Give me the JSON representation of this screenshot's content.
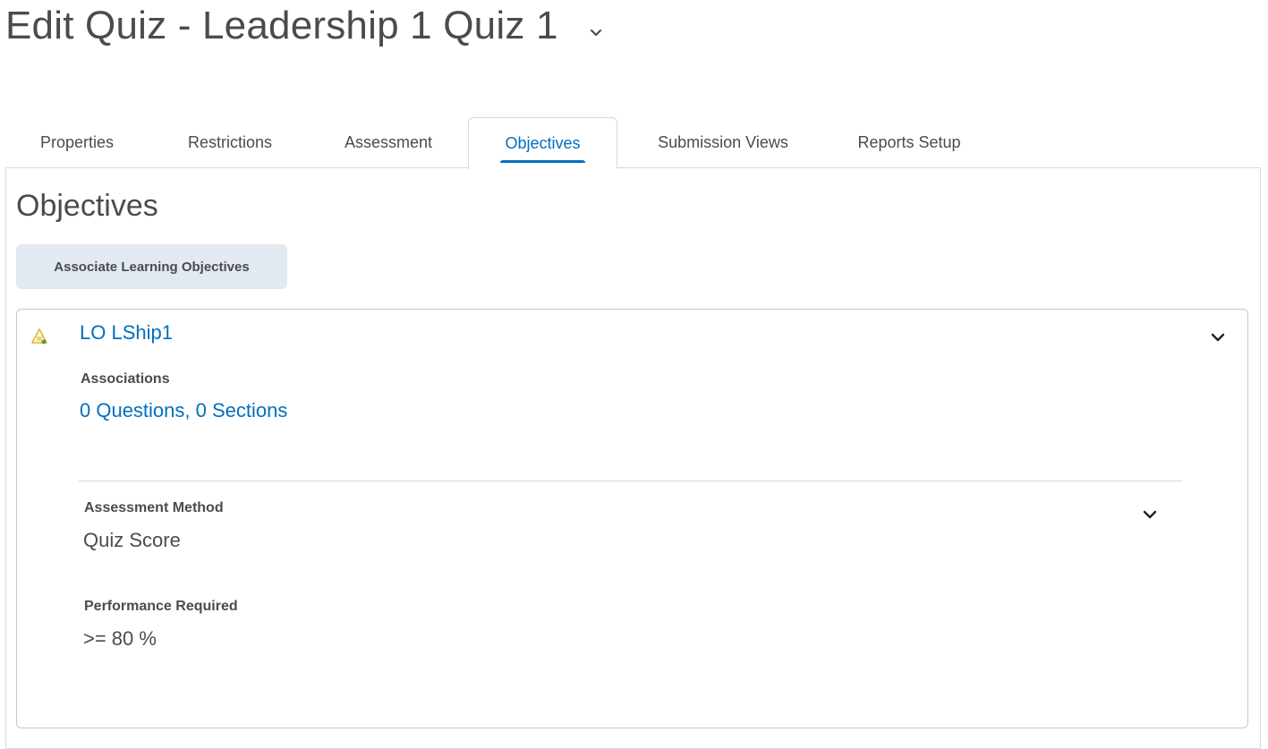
{
  "page": {
    "title": "Edit Quiz - Leadership 1 Quiz 1"
  },
  "tabs": [
    {
      "label": "Properties"
    },
    {
      "label": "Restrictions"
    },
    {
      "label": "Assessment"
    },
    {
      "label": "Objectives",
      "active": true
    },
    {
      "label": "Submission Views"
    },
    {
      "label": "Reports Setup"
    }
  ],
  "objectives": {
    "heading": "Objectives",
    "associate_button": "Associate Learning Objectives",
    "items": [
      {
        "name": "LO LShip1",
        "associations_label": "Associations",
        "associations_value": "0 Questions, 0 Sections",
        "assessment_method_label": "Assessment Method",
        "assessment_method_value": "Quiz Score",
        "performance_label": "Performance Required",
        "performance_value": ">= 80 %"
      }
    ]
  },
  "colors": {
    "link": "#006fbf",
    "text": "#494c4e",
    "button_bg": "#e3e9f1",
    "border": "#d3d9e3",
    "objective_icon": "#e8b02a"
  },
  "icons": {
    "title_menu": "chevron-down-icon",
    "objective": "learning-objective-icon",
    "card_expand": "chevron-down-icon",
    "method_expand": "chevron-down-icon"
  }
}
